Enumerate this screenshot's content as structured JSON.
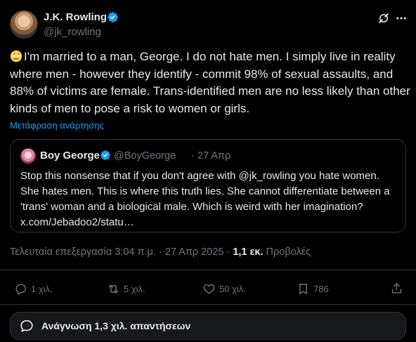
{
  "author": {
    "display_name": "J.K. Rowling",
    "handle": "@jk_rowling"
  },
  "tweet": {
    "text": "I'm married to a man, George. I do not hate men. I simply live in reality where men - however they identify - commit 98% of sexual assaults, and 88% of victims are female. Trans-identified men are no less likely than other kinds of men to pose a risk to women or girls.",
    "translate_label": "Μετάφραση ανάρτησης"
  },
  "quote": {
    "display_name": "Boy George",
    "handle": "@BoyGeorge",
    "separator": "·",
    "time": "27 Απρ",
    "text": "Stop this nonsense that if you don't agree with @jk_rowling you hate women. She hates men. This is where this truth lies. She cannot differentiate between a 'trans' woman and a biological male. Which is weird with her imagination? x.com/Jebadoo2/statu…"
  },
  "meta": {
    "edited_label": "Τελευταία επεξεργασία",
    "time": "3:04 π.μ.",
    "separator": "·",
    "date": "27 Απρ 2025",
    "views_count": "1,1 εκ.",
    "views_label": "Προβολές"
  },
  "actions": {
    "replies": "1 χιλ.",
    "reposts": "5 χιλ.",
    "likes": "50 χιλ.",
    "bookmarks": "786"
  },
  "read_replies": {
    "label": "Ανάγνωση 1,3 χιλ. απαντήσεων"
  },
  "colors": {
    "background": "#000000",
    "text": "#e7e9ea",
    "secondary": "#71767b",
    "accent": "#1d9bf0",
    "border": "#2f3336"
  }
}
